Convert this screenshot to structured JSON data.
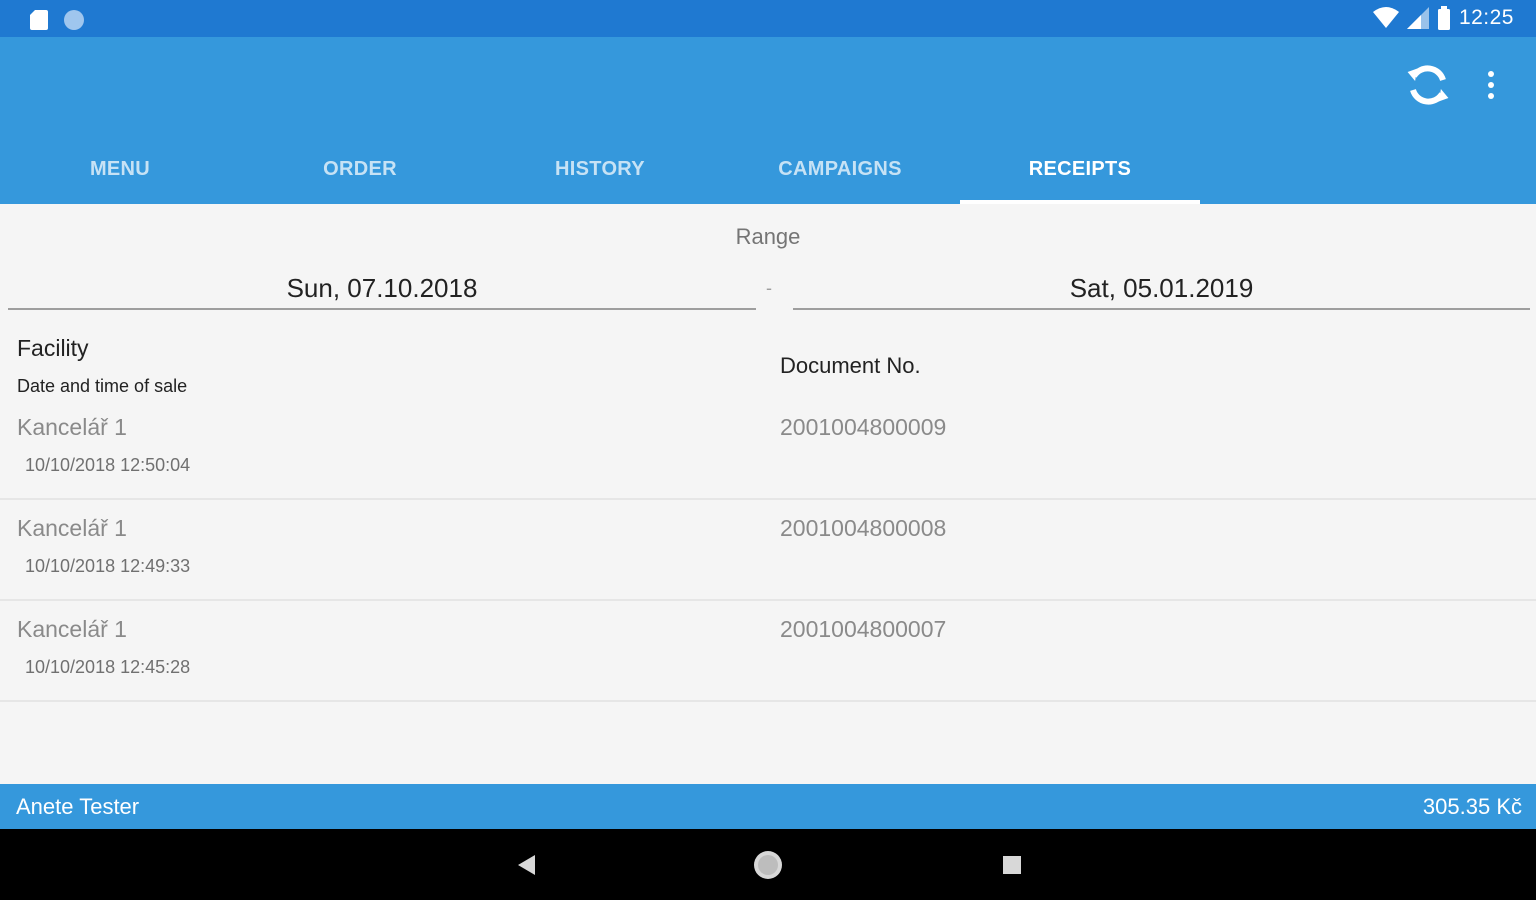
{
  "status_bar": {
    "time": "12:25",
    "icons": [
      "sd-card-icon",
      "circle-icon",
      "wifi-icon",
      "signal-icon",
      "battery-icon"
    ]
  },
  "app_bar": {
    "actions": [
      "sync-icon",
      "more-vert-icon"
    ],
    "tabs": [
      {
        "label": "MENU",
        "active": false
      },
      {
        "label": "ORDER",
        "active": false
      },
      {
        "label": "HISTORY",
        "active": false
      },
      {
        "label": "CAMPAIGNS",
        "active": false
      },
      {
        "label": "RECEIPTS",
        "active": true
      }
    ]
  },
  "range": {
    "label": "Range",
    "from": "Sun, 07.10.2018",
    "separator": "-",
    "to": "Sat, 05.01.2019"
  },
  "list_header": {
    "facility": "Facility",
    "datetime": "Date and time of sale",
    "document": "Document No."
  },
  "receipts": [
    {
      "facility": "Kancelář 1",
      "datetime": "10/10/2018 12:50:04",
      "document": "2001004800009"
    },
    {
      "facility": "Kancelář 1",
      "datetime": "10/10/2018 12:49:33",
      "document": "2001004800008"
    },
    {
      "facility": "Kancelář 1",
      "datetime": "10/10/2018 12:45:28",
      "document": "2001004800007"
    }
  ],
  "footer": {
    "user": "Anete Tester",
    "total": "305.35 Kč"
  },
  "colors": {
    "status_bar": "#1f79d1",
    "primary": "#3598dc",
    "background": "#f5f5f5"
  }
}
